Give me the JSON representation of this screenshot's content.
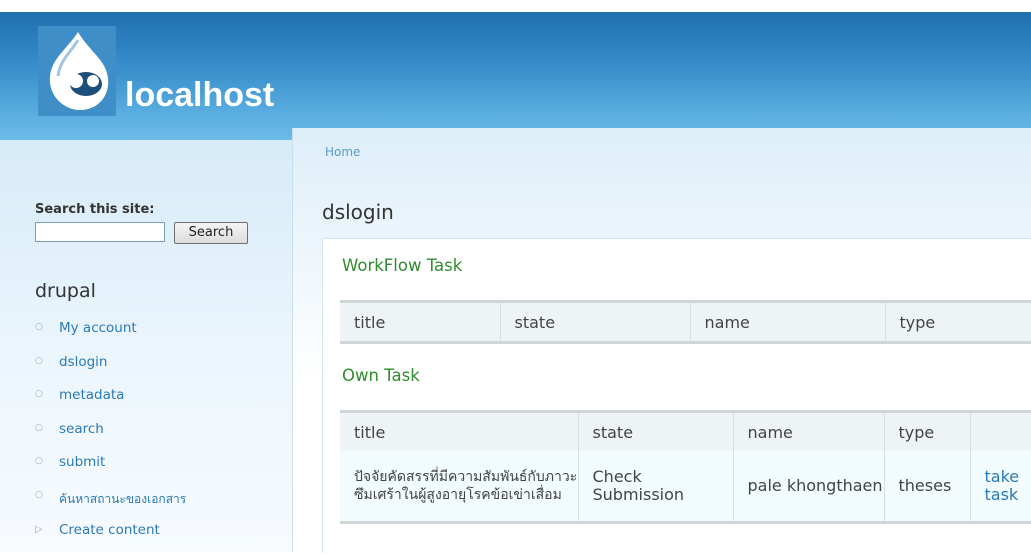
{
  "header": {
    "site_name": "localhost"
  },
  "sidebar": {
    "search_label": "Search this site:",
    "search_input_value": "",
    "search_button": "Search",
    "block_title": "drupal",
    "items": [
      {
        "label": "My account",
        "bullet": "○"
      },
      {
        "label": "dslogin",
        "bullet": "○"
      },
      {
        "label": "metadata",
        "bullet": "○"
      },
      {
        "label": "search",
        "bullet": "○"
      },
      {
        "label": "submit",
        "bullet": "○"
      },
      {
        "label": "ค้นหาสถานะของเอกสาร",
        "bullet": "○"
      },
      {
        "label": "Create content",
        "bullet": "▷"
      }
    ]
  },
  "main": {
    "breadcrumb": "Home",
    "page_title": "dslogin",
    "workflow": {
      "title": "WorkFlow Task",
      "columns": [
        "title",
        "state",
        "name",
        "type"
      ]
    },
    "own": {
      "title": "Own Task",
      "columns": [
        "title",
        "state",
        "name",
        "type",
        ""
      ],
      "rows": [
        {
          "title": "ปัจจัยคัดสรรที่มีความสัมพันธ์กับภาวะซึมเศร้าในผู้สูงอายุโรคข้อเข่าเสื่อม",
          "state": "Check Submission",
          "name": "pale khongthaen",
          "type": "theses",
          "action": "take task"
        }
      ]
    }
  },
  "colors": {
    "header_blue": "#2f7fc0",
    "link": "#2b7ab8",
    "section_green": "#2f8d2f"
  },
  "icons": {
    "logo": "drupal-drop-icon"
  }
}
